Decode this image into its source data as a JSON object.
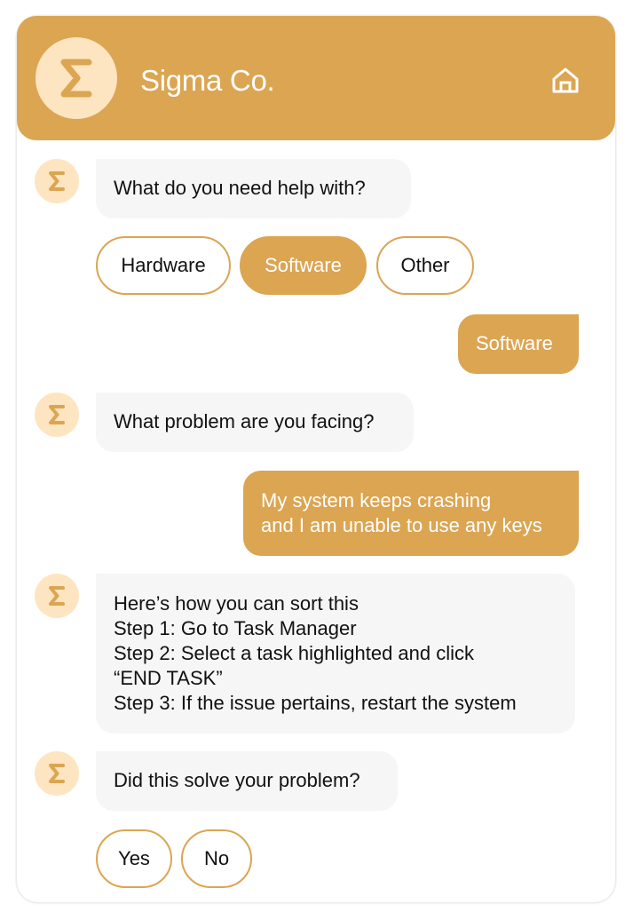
{
  "header": {
    "logo_icon": "sigma-icon",
    "title": "Sigma Co.",
    "home_icon": "home-icon"
  },
  "colors": {
    "accent": "#dba552",
    "avatar_bg": "#fee5c1",
    "bot_bubble_bg": "#f6f6f6",
    "text": "#111111"
  },
  "messages": [
    {
      "sender": "bot",
      "text": "What do you need help with?"
    },
    {
      "sender": "user",
      "text": "Software"
    },
    {
      "sender": "bot",
      "text": "What problem are you facing?"
    },
    {
      "sender": "user",
      "text": "My system keeps crashing\nand I am unable to use any keys"
    },
    {
      "sender": "bot",
      "text": "Here’s how you can sort this\nStep 1: Go to Task Manager\nStep 2: Select a task highlighted and click\n“END TASK”\nStep 3: If the issue pertains, restart the system"
    },
    {
      "sender": "bot",
      "text": "Did this solve your problem?"
    }
  ],
  "quick_replies_1": [
    {
      "label": "Hardware",
      "selected": false
    },
    {
      "label": "Software",
      "selected": true
    },
    {
      "label": "Other",
      "selected": false
    }
  ],
  "quick_replies_2": [
    {
      "label": "Yes",
      "selected": false
    },
    {
      "label": "No",
      "selected": false
    }
  ]
}
